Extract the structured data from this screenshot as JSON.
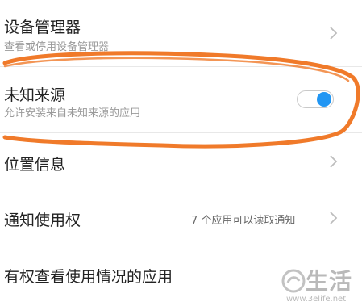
{
  "settings": {
    "device_admin": {
      "title": "设备管理器",
      "subtitle": "查看或停用设备管理器"
    },
    "unknown_sources": {
      "title": "未知来源",
      "subtitle": "允许安装来自未知来源的应用",
      "toggle_on": true,
      "toggle_color": "#2196f3"
    },
    "location": {
      "title": "位置信息"
    },
    "notification_access": {
      "title": "通知使用权",
      "value": "7 个应用可以读取通知"
    },
    "usage_access": {
      "title": "有权查看使用情况的应用"
    }
  },
  "annotation": {
    "color": "#f07a2a"
  },
  "watermark": {
    "text": "生活",
    "url": "www.3elife.net"
  }
}
